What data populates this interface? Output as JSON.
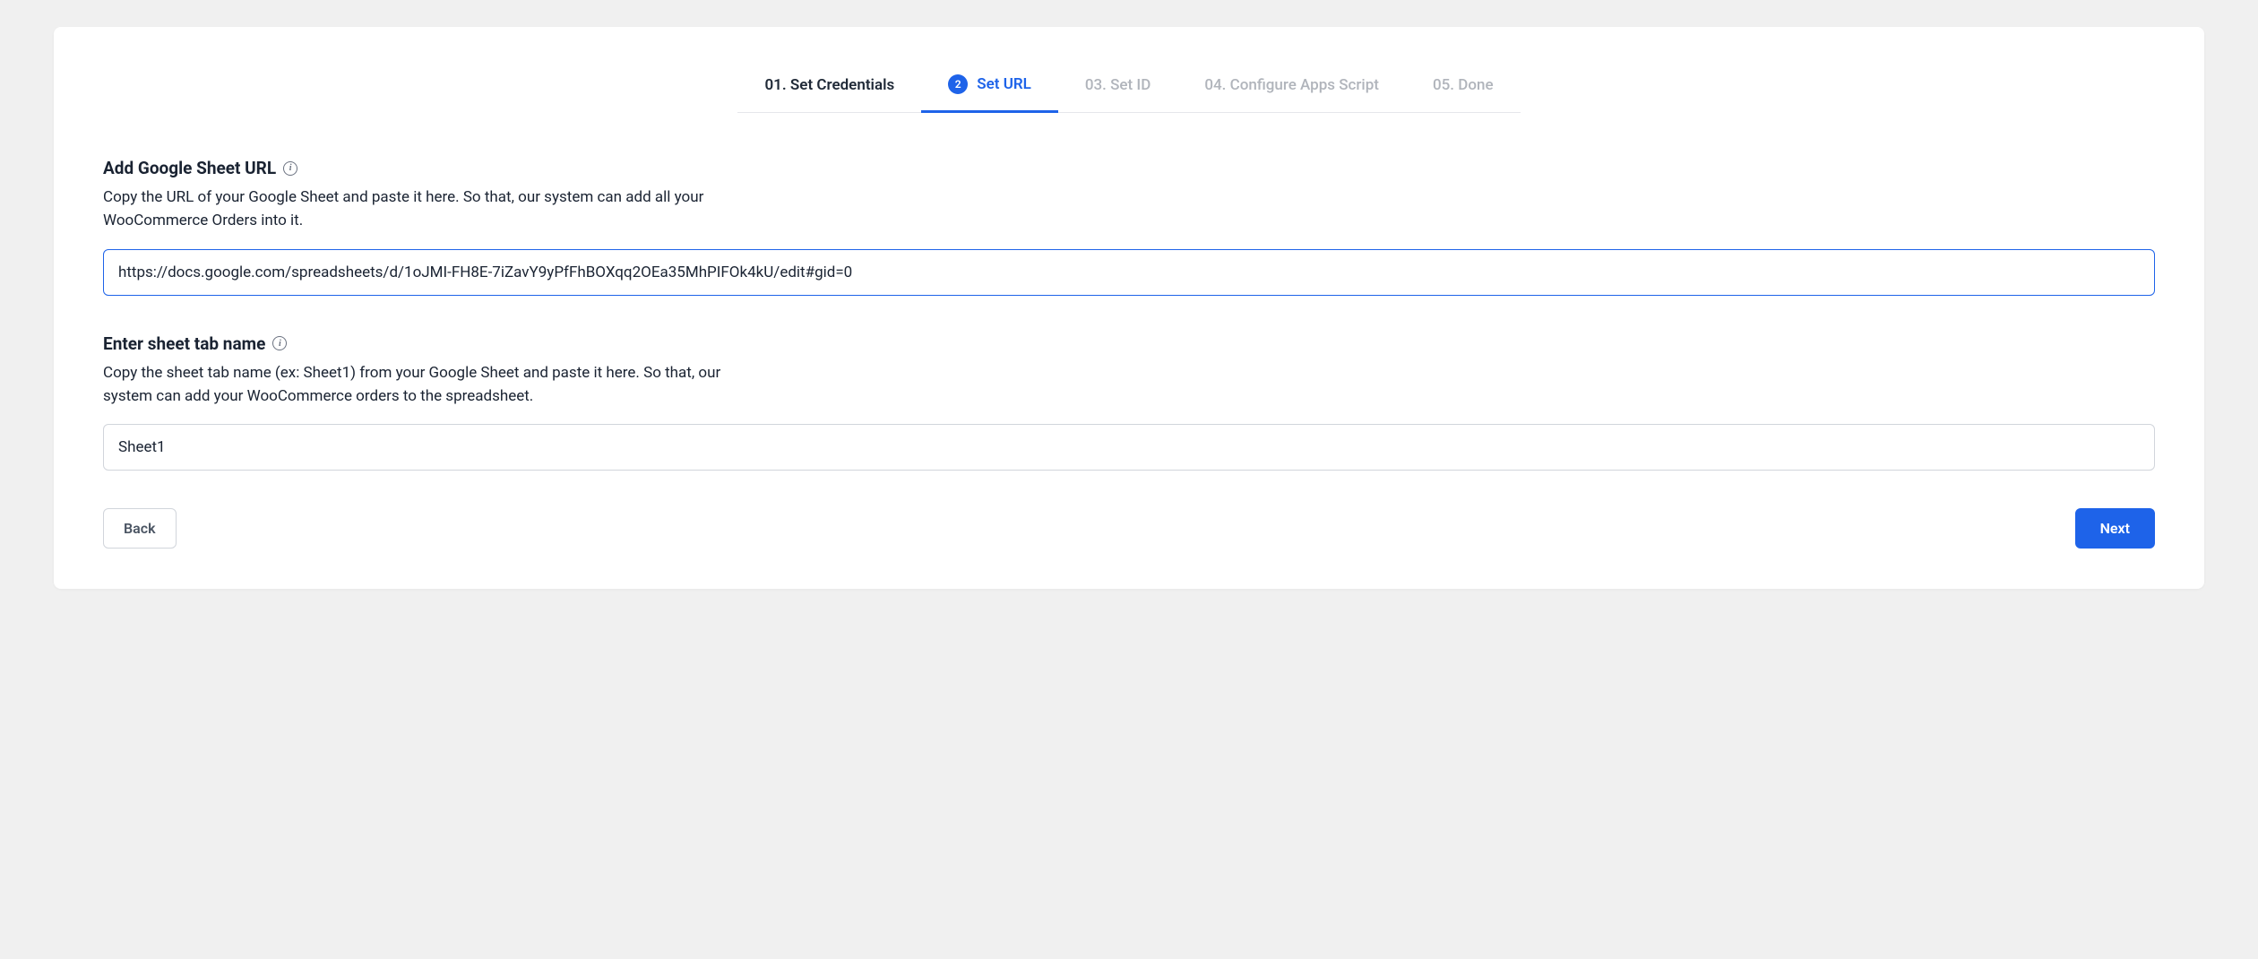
{
  "stepper": {
    "steps": [
      {
        "label": "01. Set Credentials"
      },
      {
        "number": "2",
        "label": "Set URL"
      },
      {
        "label": "03. Set ID"
      },
      {
        "label": "04. Configure Apps Script"
      },
      {
        "label": "05. Done"
      }
    ]
  },
  "sections": {
    "url": {
      "label": "Add Google Sheet URL",
      "description": "Copy the URL of your Google Sheet and paste it here. So that, our system can add all your WooCommerce Orders into it.",
      "value": "https://docs.google.com/spreadsheets/d/1oJMI-FH8E-7iZavY9yPfFhBOXqq2OEa35MhPIFOk4kU/edit#gid=0"
    },
    "tab": {
      "label": "Enter sheet tab name",
      "description": "Copy the sheet tab name (ex: Sheet1) from your Google Sheet and paste it here. So that, our system can add your WooCommerce orders to the spreadsheet.",
      "value": "Sheet1"
    }
  },
  "buttons": {
    "back": "Back",
    "next": "Next"
  }
}
